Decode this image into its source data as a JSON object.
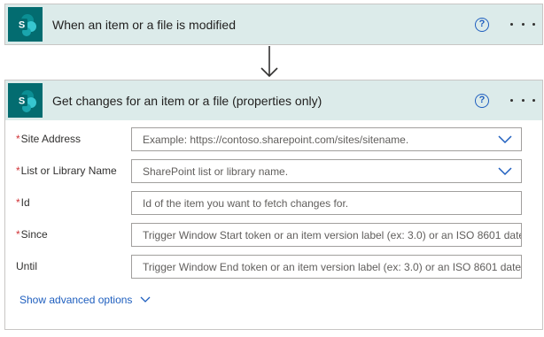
{
  "trigger_card": {
    "title": "When an item or a file is modified",
    "icon": "sharepoint-icon",
    "help_label": "?",
    "more_icon": "ellipsis-icon"
  },
  "connector_arrow": "down-arrow-icon",
  "action_card": {
    "title": "Get changes for an item or a file (properties only)",
    "icon": "sharepoint-icon",
    "help_label": "?",
    "more_icon": "ellipsis-icon",
    "required_marker": "*",
    "fields": [
      {
        "label": "Site Address",
        "required": true,
        "placeholder": "Example: https://contoso.sharepoint.com/sites/sitename.",
        "dropdown": true
      },
      {
        "label": "List or Library Name",
        "required": true,
        "placeholder": "SharePoint list or library name.",
        "dropdown": true
      },
      {
        "label": "Id",
        "required": true,
        "placeholder": "Id of the item you want to fetch changes for.",
        "dropdown": false
      },
      {
        "label": "Since",
        "required": true,
        "placeholder": "Trigger Window Start token or an item version label (ex: 3.0) or an ISO 8601 date",
        "dropdown": false
      },
      {
        "label": "Until",
        "required": false,
        "placeholder": "Trigger Window End token or an item version label (ex: 3.0) or an ISO 8601 date",
        "dropdown": false
      }
    ],
    "advanced_options_label": "Show advanced options"
  },
  "colors": {
    "header_bg": "#dcebea",
    "sharepoint": "#036c70",
    "link": "#1f5fbf",
    "required": "#d13438"
  }
}
